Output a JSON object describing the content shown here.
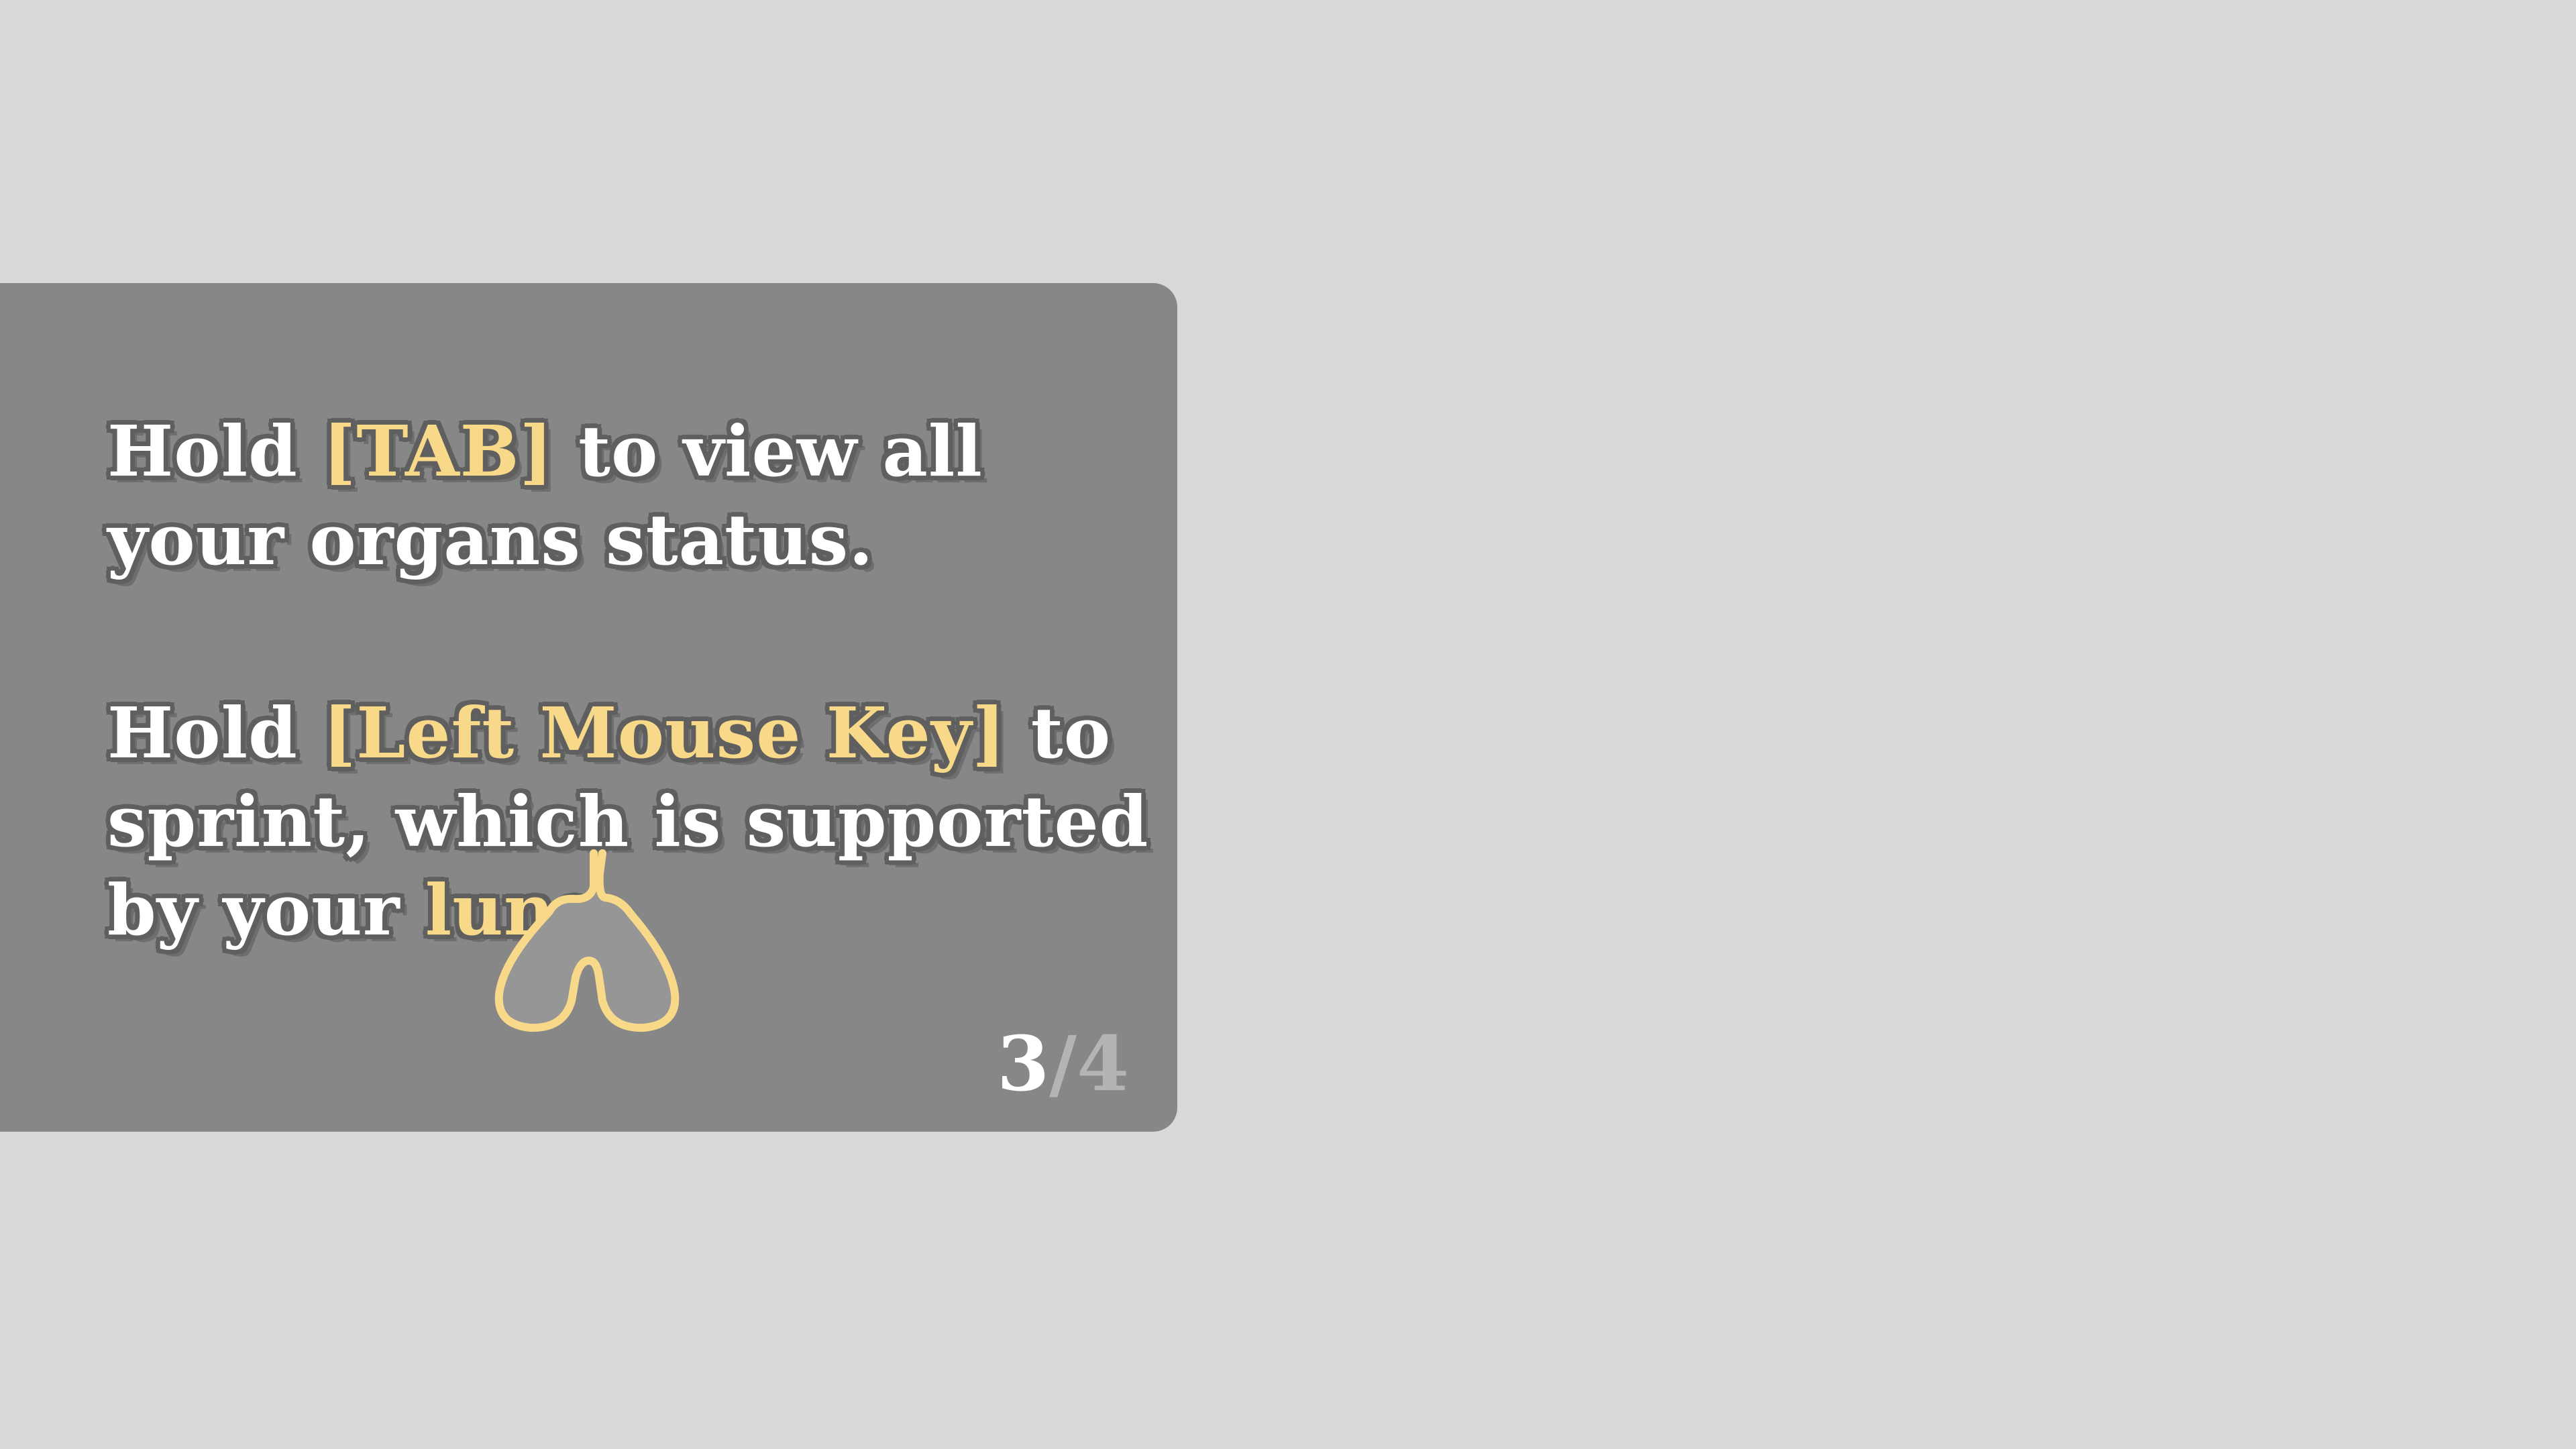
{
  "tutorial": {
    "tip1": {
      "line1_pre": "Hold ",
      "key": "[TAB]",
      "line1_post": " to view all",
      "line2": "your organs status."
    },
    "tip2": {
      "line1_pre": "Hold ",
      "key": "[Left Mouse Key]",
      "line1_post": " to",
      "line2": "sprint, which is supported",
      "line3_pre": "by your ",
      "organ": "lung",
      "line3_post": "."
    },
    "page": {
      "current": "3",
      "separator": "/",
      "total": "4"
    }
  },
  "colors": {
    "background": "#d9d9d9",
    "panel": "#878787",
    "highlight": "#f8d98a",
    "text": "#ffffff"
  },
  "icons": {
    "organ": "lung-icon"
  }
}
